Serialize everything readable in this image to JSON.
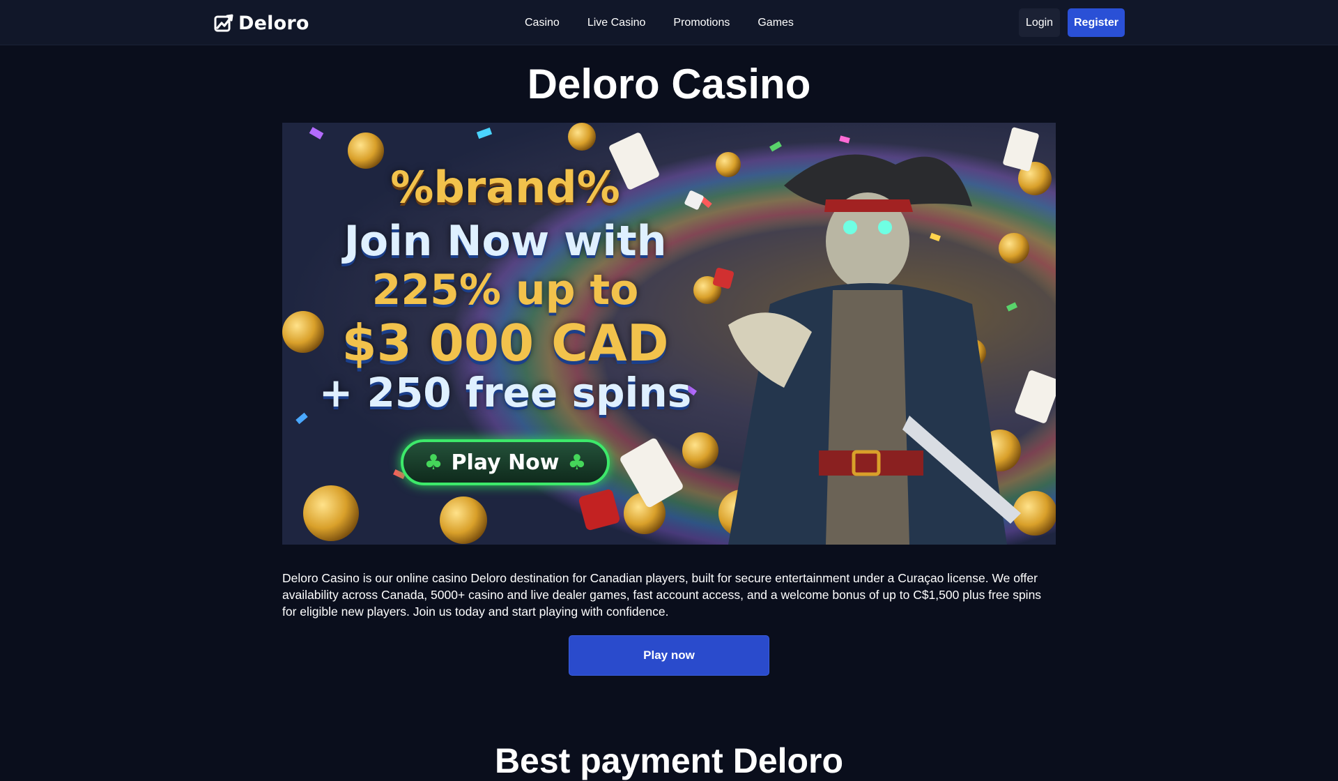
{
  "header": {
    "logo_text": "Deloro",
    "nav": [
      "Casino",
      "Live Casino",
      "Promotions",
      "Games"
    ],
    "login_label": "Login",
    "register_label": "Register"
  },
  "main": {
    "title": "Deloro Casino",
    "banner": {
      "line1": "%brand%",
      "line2": "Join Now with",
      "line3": "225% up to",
      "line4": "$3 000 CAD",
      "line5": "+ 250 free spins",
      "cta_label": "Play Now"
    },
    "intro": "Deloro Casino is our online casino Deloro destination for Canadian players, built for secure entertainment under a Curaçao license. We offer availability across Canada, 5000+ casino and live dealer games, fast account access, and a welcome bonus of up to C$1,500 plus free spins for eligible new players. Join us today and start playing with confidence.",
    "play_button_label": "Play now",
    "next_heading": "Best payment Deloro"
  },
  "colors": {
    "background": "#0a0e1c",
    "header_bg": "#111729",
    "accent_blue": "#2a50d6",
    "gold_text": "#f2c24c",
    "cta_green": "#3de96a"
  },
  "icons": [
    "logo-mark-icon",
    "clover-icon"
  ]
}
